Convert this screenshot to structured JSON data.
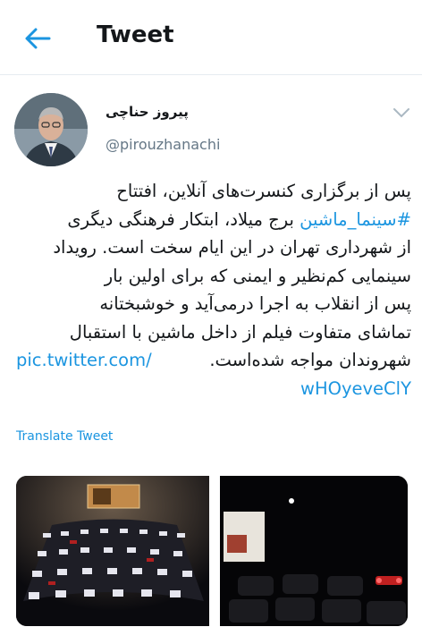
{
  "topbar": {
    "title": "Tweet"
  },
  "tweet": {
    "name": "پیروز حناچی",
    "handle": "@pirouzhanachi",
    "lines": {
      "l1": "پس از برگزاری کنسرت‌های آنلاین، افتتاح",
      "l2_hashtag": "#سینما_ماشین",
      "l2_rest": " برج میلاد، ابتکار فرهنگی دیگری",
      "l3": "از شهرداری تهران در این ایام سخت است. رویداد",
      "l4": "سینمایی کم‌نظیر و ایمنی که برای اولین بار",
      "l5": "پس از انقلاب به اجرا درمی‌آید و خوشبختانه",
      "l6": "تماشای متفاوت فیلم از داخل ماشین با استقبال",
      "l7_text": "شهروندان مواجه شده‌است.",
      "link1": "pic.twitter.com/",
      "link2": "wHOyeveClY"
    },
    "translate_label": "Translate Tweet"
  },
  "colors": {
    "accent": "#1b95e0",
    "text": "#14171a",
    "muted": "#657786"
  },
  "icons": {
    "back": "arrow-left-icon",
    "more": "chevron-down-icon"
  }
}
